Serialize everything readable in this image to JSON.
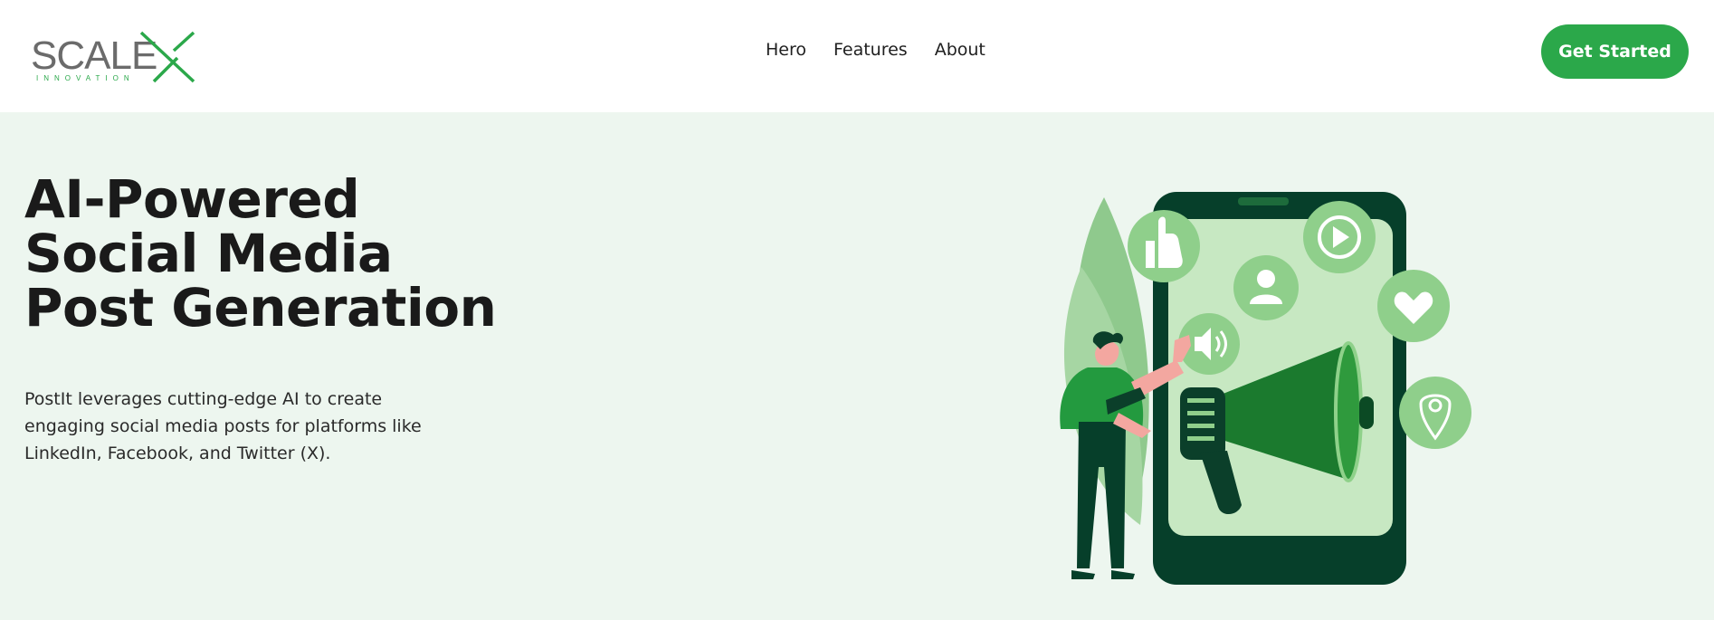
{
  "brand": {
    "name": "SCALE",
    "subtitle": "INNOVATION",
    "accent_color": "#2ba84a"
  },
  "nav": {
    "items": [
      {
        "label": "Hero"
      },
      {
        "label": "Features"
      },
      {
        "label": "About"
      }
    ]
  },
  "cta": {
    "label": "Get Started"
  },
  "hero": {
    "title": "AI-Powered Social Media Post Generation",
    "description": "PostIt leverages cutting-edge AI to create engaging social media posts for platforms like LinkedIn, Facebook, and Twitter (X).",
    "background_color": "#edf6ef"
  },
  "illustration": {
    "icons": [
      "thumbs-up-icon",
      "play-icon",
      "user-icon",
      "heart-icon",
      "speaker-icon",
      "location-pin-icon",
      "megaphone-icon"
    ]
  }
}
